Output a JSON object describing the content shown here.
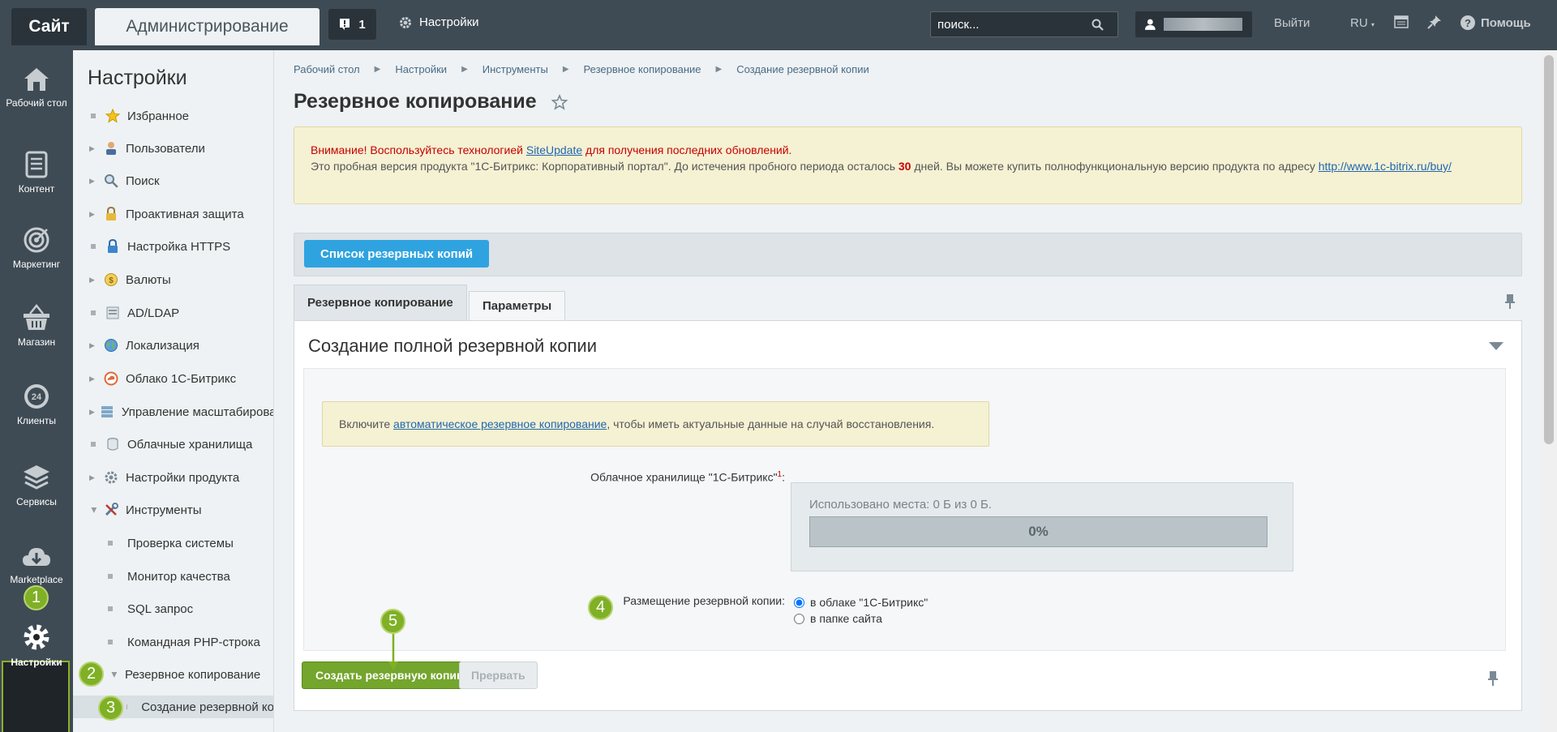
{
  "topbar": {
    "site_tab": "Сайт",
    "admin_tab": "Администрирование",
    "notifications_count": "1",
    "settings_label": "Настройки",
    "search_placeholder": "поиск...",
    "logout_label": "Выйти",
    "lang_label": "RU",
    "help_label": "Помощь"
  },
  "left_menu": {
    "items": [
      {
        "label": "Рабочий стол",
        "icon": "home-icon"
      },
      {
        "label": "Контент",
        "icon": "content-icon"
      },
      {
        "label": "Маркетинг",
        "icon": "target-icon"
      },
      {
        "label": "Магазин",
        "icon": "basket-icon"
      },
      {
        "label": "Клиенты",
        "icon": "clock-24-icon"
      },
      {
        "label": "Сервисы",
        "icon": "layers-icon"
      },
      {
        "label": "Marketplace",
        "icon": "cloud-download-icon"
      },
      {
        "label": "Настройки",
        "icon": "gear-icon"
      }
    ],
    "active": "Настройки"
  },
  "sidebar": {
    "title": "Настройки",
    "items": [
      {
        "label": "Избранное",
        "icon": "star-icon"
      },
      {
        "label": "Пользователи",
        "icon": "users-icon"
      },
      {
        "label": "Поиск",
        "icon": "search-icon"
      },
      {
        "label": "Проактивная защита",
        "icon": "lock-icon"
      },
      {
        "label": "Настройка HTTPS",
        "icon": "https-lock-icon"
      },
      {
        "label": "Валюты",
        "icon": "currency-icon"
      },
      {
        "label": "AD/LDAP",
        "icon": "ldap-icon"
      },
      {
        "label": "Локализация",
        "icon": "globe-icon"
      },
      {
        "label": "Облако 1С-Битрикс",
        "icon": "cloud-icon"
      },
      {
        "label": "Управление масштабирова",
        "icon": "scale-icon"
      },
      {
        "label": "Облачные хранилища",
        "icon": "storage-icon"
      },
      {
        "label": "Настройки продукта",
        "icon": "gear-icon"
      },
      {
        "label": "Инструменты",
        "icon": "tools-icon"
      },
      {
        "label": "Проверка системы"
      },
      {
        "label": "Монитор качества"
      },
      {
        "label": "SQL запрос"
      },
      {
        "label": "Командная PHP-строка"
      },
      {
        "label": "Резервное копирование"
      },
      {
        "label": "Создание резервной ко"
      }
    ]
  },
  "breadcrumb": [
    "Рабочий стол",
    "Настройки",
    "Инструменты",
    "Резервное копирование",
    "Создание резервной копии"
  ],
  "page_title": "Резервное копирование",
  "alert": {
    "warn_prefix": "Внимание! Воспользуйтесь технологией",
    "link": "SiteUpdate",
    "warn_suffix": "для получения последних обновлений.",
    "trial_text": "Это пробная версия продукта \"1С-Битрикс: Корпоративный портал\". До истечения пробного периода осталось",
    "days": "30",
    "trial_text_2": "дней. Вы можете купить полнофункциональную версию продукта по адресу",
    "buy_link": "http://www.1c-bitrix.ru/buy/"
  },
  "toolbar": {
    "list_button": "Список резервных копий"
  },
  "tabs": [
    "Резервное копирование",
    "Параметры"
  ],
  "section": {
    "title": "Создание полной резервной копии",
    "note_prefix": "Включите",
    "note_link": "автоматическое резервное копирование",
    "note_suffix": ", чтобы иметь актуальные данные на случай восстановления.",
    "cloud_label": "Облачное хранилище \"1С-Битрикс\"",
    "cloud_footnote": "1",
    "quota_text": "Использовано места: 0 Б из 0 Б.",
    "quota_percent": "0%",
    "quota_fraction": 0,
    "placement_label": "Размещение резервной копии:",
    "placement_options": [
      "в облаке \"1С-Битрикс\"",
      "в папке сайта"
    ],
    "placement_selected": "в облаке \"1С-Битрикс\""
  },
  "buttons": {
    "create": "Создать резервную копию",
    "stop": "Прервать"
  },
  "annotations": [
    "1",
    "2",
    "3",
    "4",
    "5"
  ],
  "colors": {
    "accent_green": "#74a52c",
    "accent_blue": "#2fa3e0",
    "topbar": "#3f4b54"
  }
}
